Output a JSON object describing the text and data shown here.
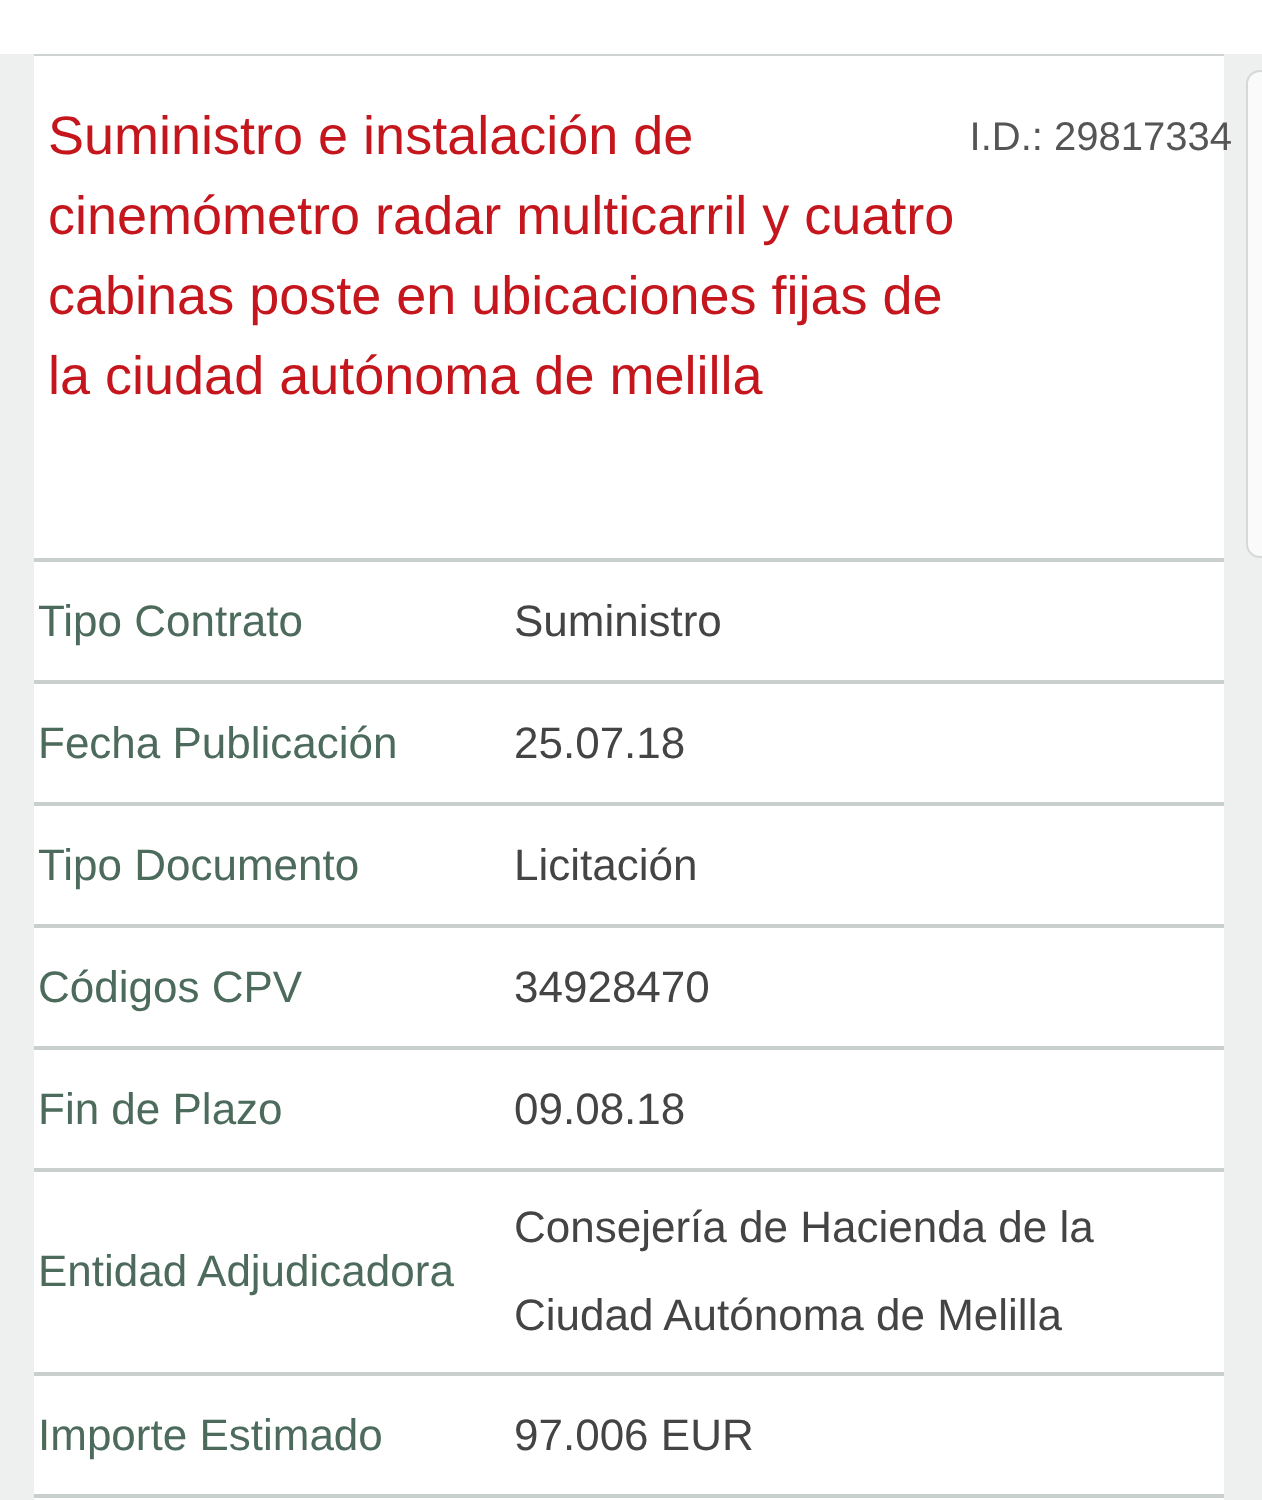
{
  "title": "Suministro e instalación de cinemómetro radar multicarril y cuatro cabinas poste en ubicaciones fijas de la ciudad autónoma de melilla",
  "id_label": "I.D.: 29817334",
  "fields": [
    {
      "label": "Tipo Contrato",
      "value": "Suministro"
    },
    {
      "label": "Fecha Publicación",
      "value": "25.07.18"
    },
    {
      "label": "Tipo Documento",
      "value": "Licitación"
    },
    {
      "label": "Códigos CPV",
      "value": "34928470"
    },
    {
      "label": "Fin de Plazo",
      "value": "09.08.18"
    },
    {
      "label": "Entidad Adjudicadora",
      "value": "Consejería de Hacienda de la Ciudad Autónoma de Melilla"
    },
    {
      "label": "Importe Estimado",
      "value": "97.006 EUR"
    }
  ]
}
